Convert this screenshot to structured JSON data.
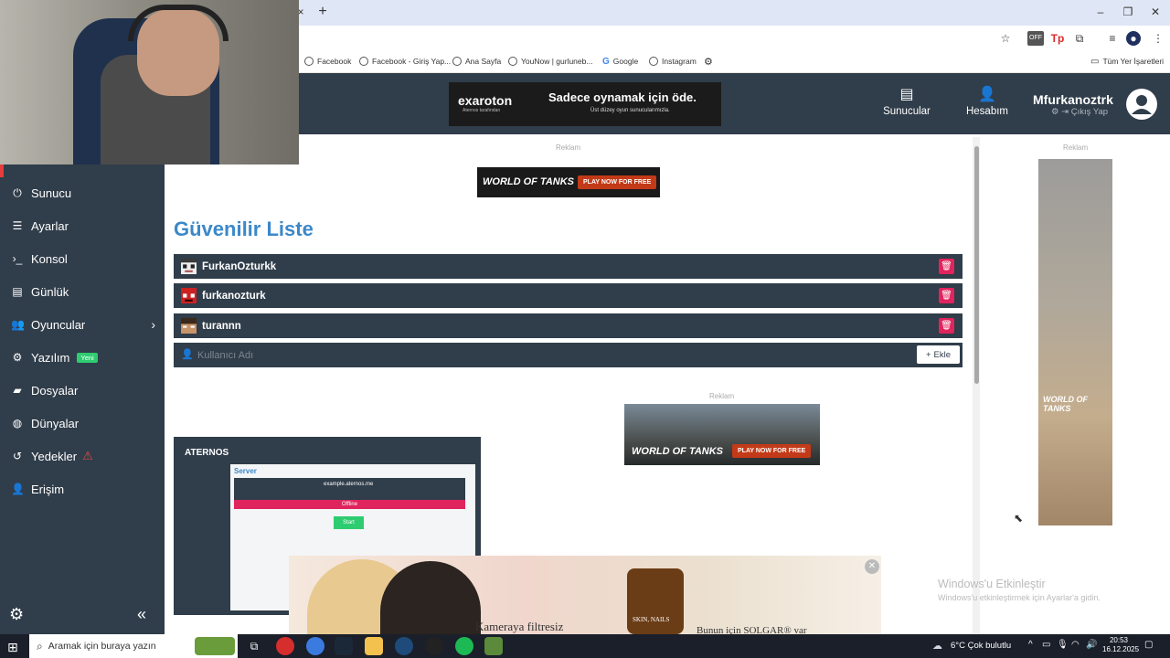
{
  "browser": {
    "tab_close": "×",
    "tab_new": "+",
    "bookmarks": [
      {
        "label": "Facebook"
      },
      {
        "label": "Facebook - Giriş Yap..."
      },
      {
        "label": "Ana Sayfa"
      },
      {
        "label": "YouNow | gurluneb..."
      },
      {
        "label": "Google"
      },
      {
        "label": "Instagram"
      }
    ],
    "all_bookmarks": "Tüm Yer İşaretleri"
  },
  "header": {
    "ad": {
      "brand": "exaroton",
      "brand_sub": "Aternos tarafından",
      "title": "Sadece oynamak için öde.",
      "subtitle": "Üst düzey oyun sunucularımızla."
    },
    "nav": [
      {
        "label": "Sunucular",
        "icon": "server-icon"
      },
      {
        "label": "Hesabım",
        "icon": "account-icon"
      }
    ],
    "username": "Mfurkanoztrk",
    "logout": "Çıkış Yap"
  },
  "sidebar": {
    "items": [
      {
        "label": "Sunucu",
        "icon": "power-icon",
        "glyph": "⏻"
      },
      {
        "label": "Ayarlar",
        "icon": "sliders-icon",
        "glyph": "☰"
      },
      {
        "label": "Konsol",
        "icon": "terminal-icon",
        "glyph": "›_"
      },
      {
        "label": "Günlük",
        "icon": "file-icon",
        "glyph": "▤"
      },
      {
        "label": "Oyuncular",
        "icon": "users-icon",
        "glyph": "👥"
      },
      {
        "label": "Yazılım",
        "icon": "software-icon",
        "glyph": "⚙",
        "badge": "Yeni"
      },
      {
        "label": "Dosyalar",
        "icon": "folder-icon",
        "glyph": "▰"
      },
      {
        "label": "Dünyalar",
        "icon": "globe-icon",
        "glyph": "◍"
      },
      {
        "label": "Yedekler",
        "icon": "history-icon",
        "glyph": "↺",
        "warning": "⚠"
      },
      {
        "label": "Erişim",
        "icon": "user-lock-icon",
        "glyph": "👤"
      }
    ]
  },
  "main": {
    "reklam": "Reklam",
    "ad_wot_logo": "WORLD OF TANKS",
    "ad_wot_btn": "PLAY NOW FOR FREE",
    "title": "Güvenilir Liste",
    "whitelist": [
      {
        "name": "FurkanOzturkk"
      },
      {
        "name": "furkanozturk"
      },
      {
        "name": "turannn"
      }
    ],
    "add_placeholder": "Kullanıcı Adı",
    "add_button": "Ekle",
    "preview": {
      "brand": "ATERNOS",
      "heading": "Server",
      "address": "example.aternos.me",
      "status": "Offline",
      "start": "Start"
    },
    "bottom_ad": {
      "text": "Kameraya filtresiz",
      "text2": "Bunun için SOLGAR® var",
      "bottle_label": "SKIN, NAILS"
    }
  },
  "windows": {
    "activate_title": "Windows'u Etkinleştir",
    "activate_sub": "Windows'u etkinleştirmek için Ayarlar'a gidin."
  },
  "taskbar": {
    "search_placeholder": "Aramak için buraya yazın",
    "weather": "6°C  Çok bulutlu",
    "time": "20:53",
    "date": "16.12.2025"
  }
}
